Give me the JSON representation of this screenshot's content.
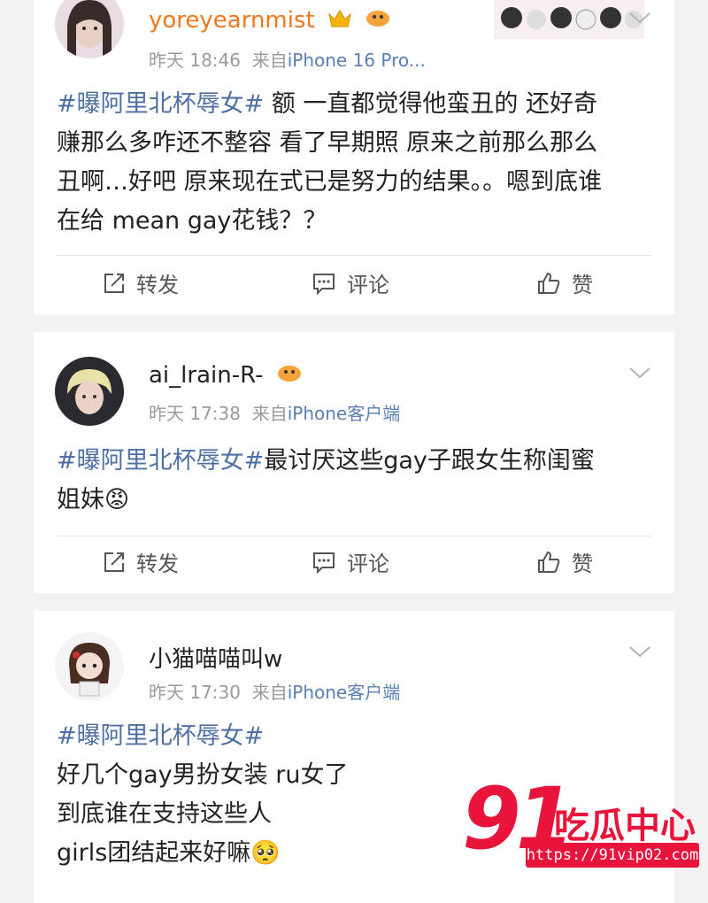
{
  "posts": [
    {
      "username": "yoreyearnmist",
      "time": "昨天 18:46",
      "source_prefix": "来自",
      "source": "iPhone 16 Pro...",
      "lines": [
        {
          "tag": "#曝阿里北杯辱女#",
          "text": " 额 一直都觉得他蛮丑的 还好奇"
        },
        {
          "tag": "",
          "text": "赚那么多咋还不整容 看了早期照 原来之前那么那么"
        },
        {
          "tag": "",
          "text": "丑啊…好吧 原来现在式已是努力的结果。。嗯到底谁"
        },
        {
          "tag": "",
          "text": "在给 mean gay花钱？？"
        }
      ]
    },
    {
      "username": "ai_lrain-R-",
      "time": "昨天 17:38",
      "source_prefix": "来自",
      "source": "iPhone客户端",
      "lines": [
        {
          "tag": "#曝阿里北杯辱女#",
          "text": "最讨厌这些gay子跟女生称闺蜜"
        },
        {
          "tag": "",
          "text": "姐妹😡"
        }
      ]
    },
    {
      "username": "小猫喵喵叫w",
      "time": "昨天 17:30",
      "source_prefix": "来自",
      "source": "iPhone客户端",
      "lines": [
        {
          "tag": "#曝阿里北杯辱女#",
          "text": ""
        },
        {
          "tag": "",
          "text": "好几个gay男扮女装 ru女了"
        },
        {
          "tag": "",
          "text": " 到底谁在支持这些人"
        },
        {
          "tag": "",
          "text": "girls团结起来好嘛🥺"
        }
      ]
    }
  ],
  "actions": {
    "repost": "转发",
    "comment": "评论",
    "like": "赞"
  },
  "icons": {
    "repost": "share-icon",
    "comment": "comment-icon",
    "like": "thumbs-up-icon",
    "more": "chevron-down-icon"
  },
  "watermark": {
    "number": "91",
    "name": "吃瓜中心",
    "url": "https://91vip02.com"
  },
  "colors": {
    "accent_link": "#4d6fa3",
    "vip_name": "#f0781e",
    "watermark": "#e8143c"
  }
}
